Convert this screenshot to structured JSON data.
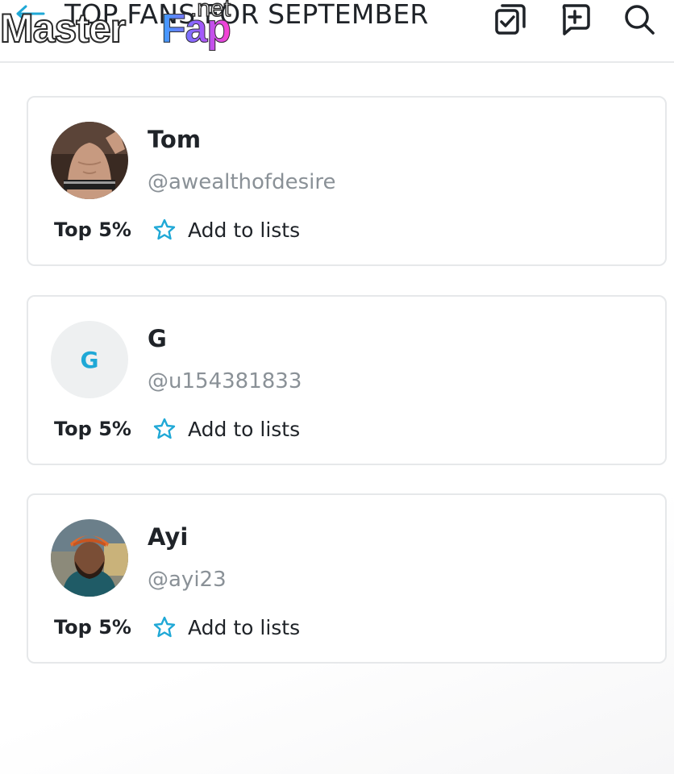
{
  "header": {
    "title": "TOP FANS FOR SEPTEMBER",
    "back_icon": "arrow-left-icon",
    "icons": [
      "checklist-icon",
      "add-post-icon",
      "search-icon"
    ]
  },
  "watermark": {
    "master": "Master",
    "fap": "Fap",
    "net": ".net"
  },
  "colors": {
    "accent": "#1fa8d6",
    "text": "#1f2328",
    "muted": "#8a9197",
    "border": "#e6e8ea"
  },
  "fans": [
    {
      "name": "Tom",
      "handle": "@awealthofdesire",
      "rank": "Top 5%",
      "action": "Add to lists",
      "avatar": "photo"
    },
    {
      "name": "G",
      "handle": "@u154381833",
      "rank": "Top 5%",
      "action": "Add to lists",
      "avatar": "letter",
      "avatar_letter": "G"
    },
    {
      "name": "Ayi",
      "handle": "@ayi23",
      "rank": "Top 5%",
      "action": "Add to lists",
      "avatar": "photo"
    }
  ]
}
